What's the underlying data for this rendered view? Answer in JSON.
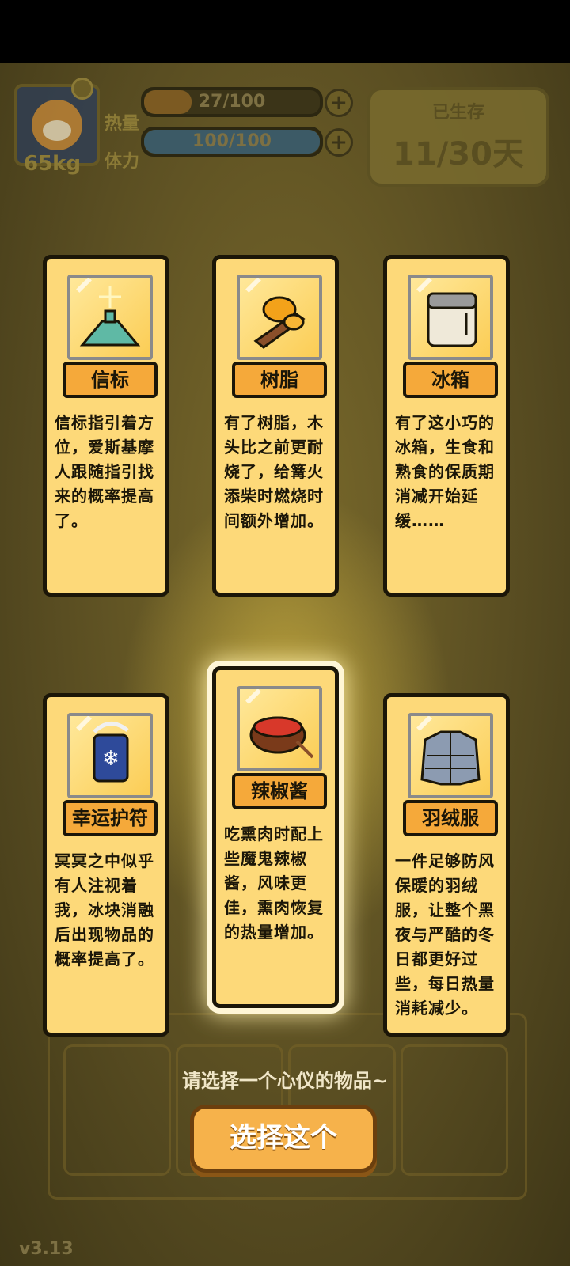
{
  "hud": {
    "weight": "65kg",
    "heat_label": "热量",
    "heat_value": "27/100",
    "heat_fill": 0.27,
    "stamina_label": "体力",
    "stamina_value": "100/100",
    "stamina_fill": 1.0,
    "survived_label": "已生存",
    "survived_days": "11/30天"
  },
  "cards": [
    {
      "name": "信标",
      "icon": "beacon-icon",
      "description": "信标指引着方位，爱斯基摩人跟随指引找来的概率提高了。"
    },
    {
      "name": "树脂",
      "icon": "resin-icon",
      "description": "有了树脂，木头比之前更耐烧了，给篝火添柴时燃烧时间额外增加。"
    },
    {
      "name": "冰箱",
      "icon": "fridge-icon",
      "description": "有了这小巧的冰箱，生食和熟食的保质期消减开始延缓……"
    },
    {
      "name": "幸运护符",
      "icon": "amulet-icon",
      "description": "冥冥之中似乎有人注视着我，冰块消融后出现物品的概率提高了。"
    },
    {
      "name": "辣椒酱",
      "icon": "chili-sauce-icon",
      "description": "吃熏肉时配上些魔鬼辣椒酱，风味更佳，熏肉恢复的热量增加。"
    },
    {
      "name": "羽绒服",
      "icon": "down-jacket-icon",
      "description": "一件足够防风保暖的羽绒服，让整个黑夜与严酷的冬日都更好过些，每日热量消耗减少。"
    }
  ],
  "selected_card": "辣椒酱",
  "prompt": "请选择一个心仪的物品~",
  "choose_button": "选择这个",
  "version": "v3.13",
  "colors": {
    "card_bg": "#fdd979",
    "plate": "#f5a93a",
    "button": "#f6b24b"
  }
}
